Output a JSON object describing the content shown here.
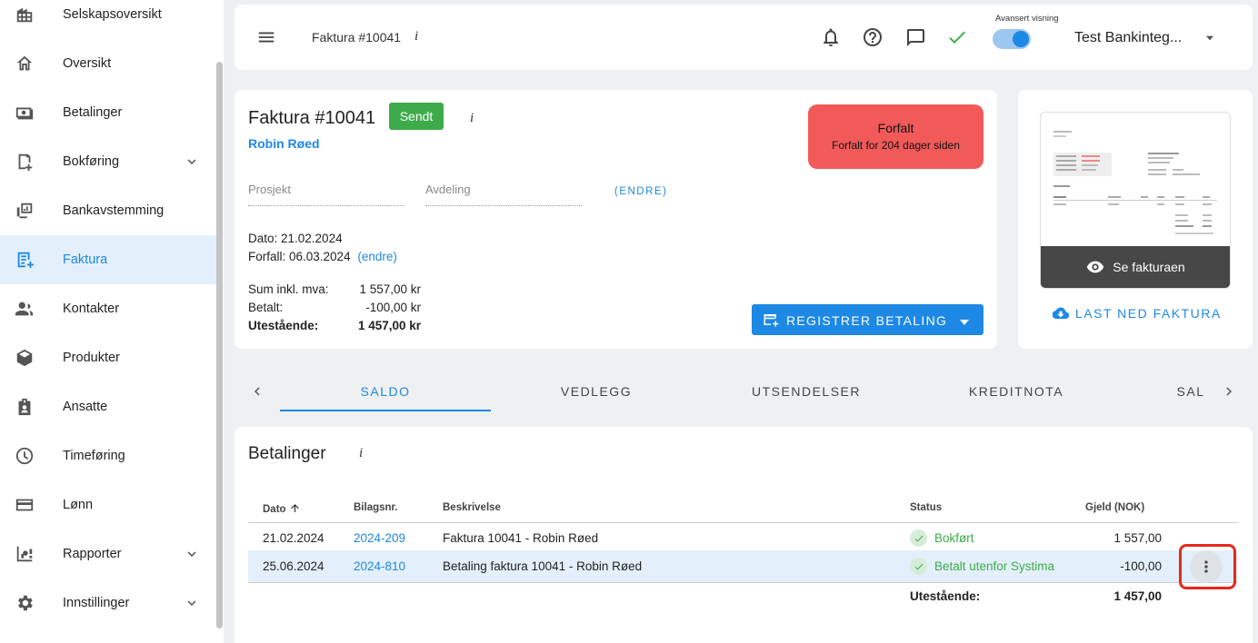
{
  "sidebar": {
    "items": [
      {
        "label": "Selskapsoversikt",
        "icon": "company-overview-icon"
      },
      {
        "label": "Oversikt",
        "icon": "home-icon"
      },
      {
        "label": "Betalinger",
        "icon": "payments-icon"
      },
      {
        "label": "Bokføring",
        "icon": "bookkeeping-icon",
        "expandable": true
      },
      {
        "label": "Bankavstemming",
        "icon": "bank-reconciliation-icon"
      },
      {
        "label": "Faktura",
        "icon": "invoice-icon",
        "active": true
      },
      {
        "label": "Kontakter",
        "icon": "contacts-icon"
      },
      {
        "label": "Produkter",
        "icon": "products-icon"
      },
      {
        "label": "Ansatte",
        "icon": "employees-icon"
      },
      {
        "label": "Timeføring",
        "icon": "clock-icon"
      },
      {
        "label": "Lønn",
        "icon": "payroll-card-icon"
      },
      {
        "label": "Rapporter",
        "icon": "reports-icon",
        "expandable": true
      },
      {
        "label": "Innstillinger",
        "icon": "gear-icon",
        "expandable": true
      }
    ]
  },
  "topbar": {
    "title": "Faktura #10041",
    "info": "i",
    "toggle_label": "Avansert visning",
    "toggle_on": true,
    "company": "Test Bankinteg..."
  },
  "invoice": {
    "title": "Faktura #10041",
    "status_badge": "Sendt",
    "info": "i",
    "customer": "Robin Røed",
    "overdue_title": "Forfalt",
    "overdue_sub": "Forfalt for 204 dager siden",
    "project_placeholder": "Prosjekt",
    "department_placeholder": "Avdeling",
    "edit_link": "(ENDRE)",
    "date_line": "Dato: 21.02.2024",
    "due_line": "Forfall: 06.03.2024",
    "due_edit": "(endre)",
    "sum_label": "Sum inkl. mva:",
    "sum_value": "1 557,00 kr",
    "paid_label": "Betalt:",
    "paid_value": "-100,00 kr",
    "outstanding_label": "Utestående:",
    "outstanding_value": "1 457,00 kr",
    "register_button": "REGISTRER BETALING"
  },
  "preview": {
    "view_label": "Se fakturaen",
    "download_label": "LAST NED FAKTURA"
  },
  "tabs": {
    "items": [
      "SALDO",
      "VEDLEGG",
      "UTSENDELSER",
      "KREDITNOTA",
      "SAL"
    ],
    "active": 0
  },
  "payments": {
    "title": "Betalinger",
    "info": "i",
    "columns": {
      "date": "Dato",
      "voucher": "Bilagsnr.",
      "description": "Beskrivelse",
      "status": "Status",
      "debt": "Gjeld (NOK)"
    },
    "rows": [
      {
        "date": "21.02.2024",
        "voucher": "2024-209",
        "description": "Faktura 10041 - Robin Røed",
        "status": "Bokført",
        "debt": "1 557,00"
      },
      {
        "date": "25.06.2024",
        "voucher": "2024-810",
        "description": "Betaling faktura 10041 - Robin Røed",
        "status": "Betalt utenfor Systima",
        "debt": "-100,00"
      }
    ],
    "total_label": "Utestående:",
    "total_value": "1 457,00"
  },
  "colors": {
    "accent": "#1e88e5",
    "success": "#3dab4a",
    "danger": "#f25a5a",
    "callout": "#e8271e"
  }
}
